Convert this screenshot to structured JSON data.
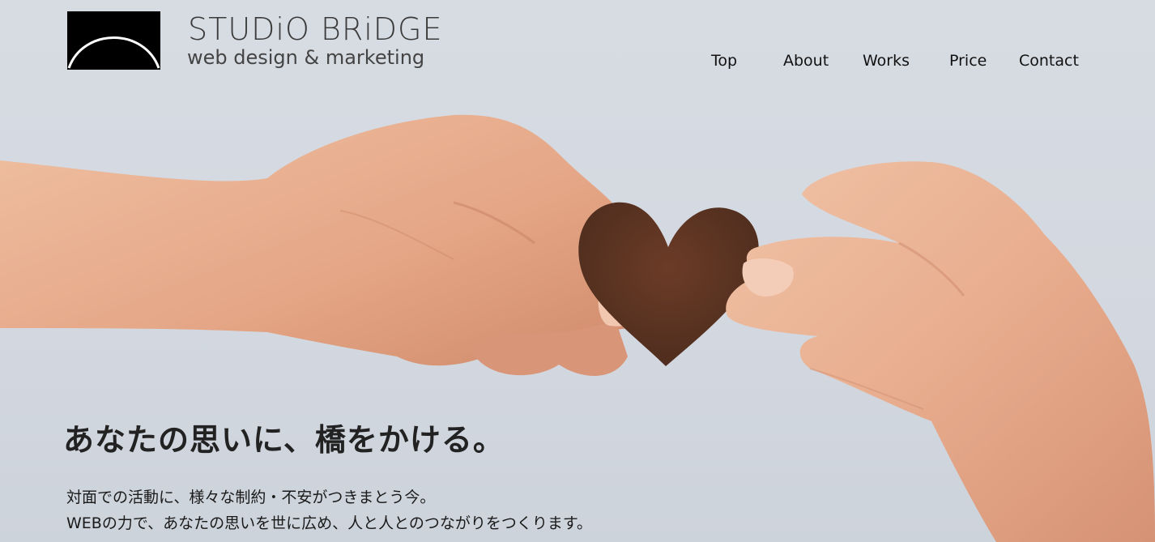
{
  "brand": {
    "name": "STUDiO BRiDGE",
    "tagline": "web design & marketing",
    "logo_icon": "bridge-arc-logo"
  },
  "nav": {
    "items": [
      {
        "label": "Top"
      },
      {
        "label": "About"
      },
      {
        "label": "Works"
      },
      {
        "label": "Price"
      },
      {
        "label": "Contact"
      }
    ]
  },
  "hero": {
    "headline": "あなたの思いに、橋をかける。",
    "lead_line_1": "対面での活動に、様々な制約・不安がつきまとう今。",
    "lead_line_2": "WEBの力で、あなたの思いを世に広め、人と人とのつながりをつくります。",
    "image": "hands-passing-heart-photo"
  },
  "colors": {
    "background": "#d6dbe2",
    "text": "#1c1c1c",
    "skin": "#e4a585",
    "heart": "#5a3322"
  }
}
